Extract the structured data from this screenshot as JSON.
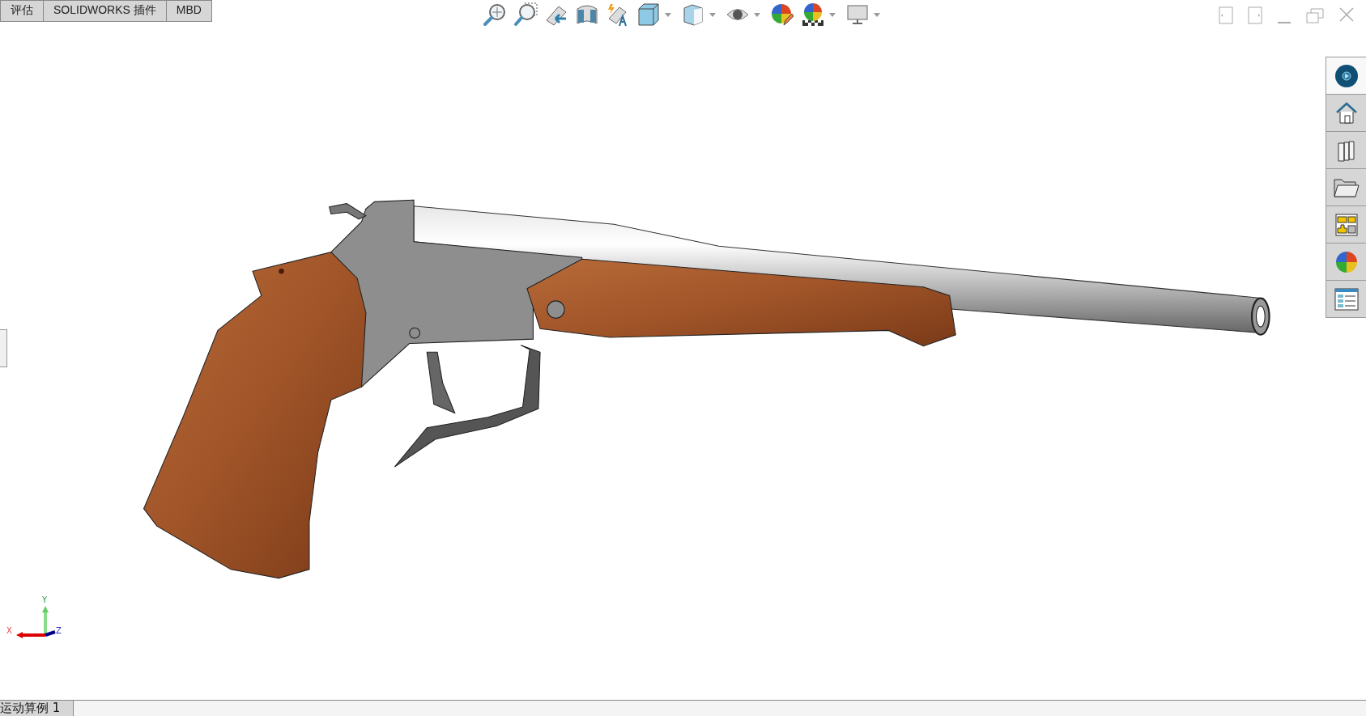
{
  "command_tabs": [
    {
      "label": "评估",
      "selected": false
    },
    {
      "label": "SOLIDWORKS 插件",
      "selected": false
    },
    {
      "label": "MBD",
      "selected": false
    }
  ],
  "task_pane": [
    {
      "kind": "sw-resources",
      "selected": true
    },
    {
      "kind": "home",
      "selected": false
    },
    {
      "kind": "library",
      "selected": false
    },
    {
      "kind": "folder",
      "selected": false
    },
    {
      "kind": "palette",
      "selected": false
    },
    {
      "kind": "appearances",
      "selected": false
    },
    {
      "kind": "properties",
      "selected": false
    }
  ],
  "axis_triad": {
    "x": "X",
    "y": "Y",
    "z": "Z"
  },
  "status_tabs": [
    {
      "label": "运动算例 1",
      "selected": true
    }
  ]
}
